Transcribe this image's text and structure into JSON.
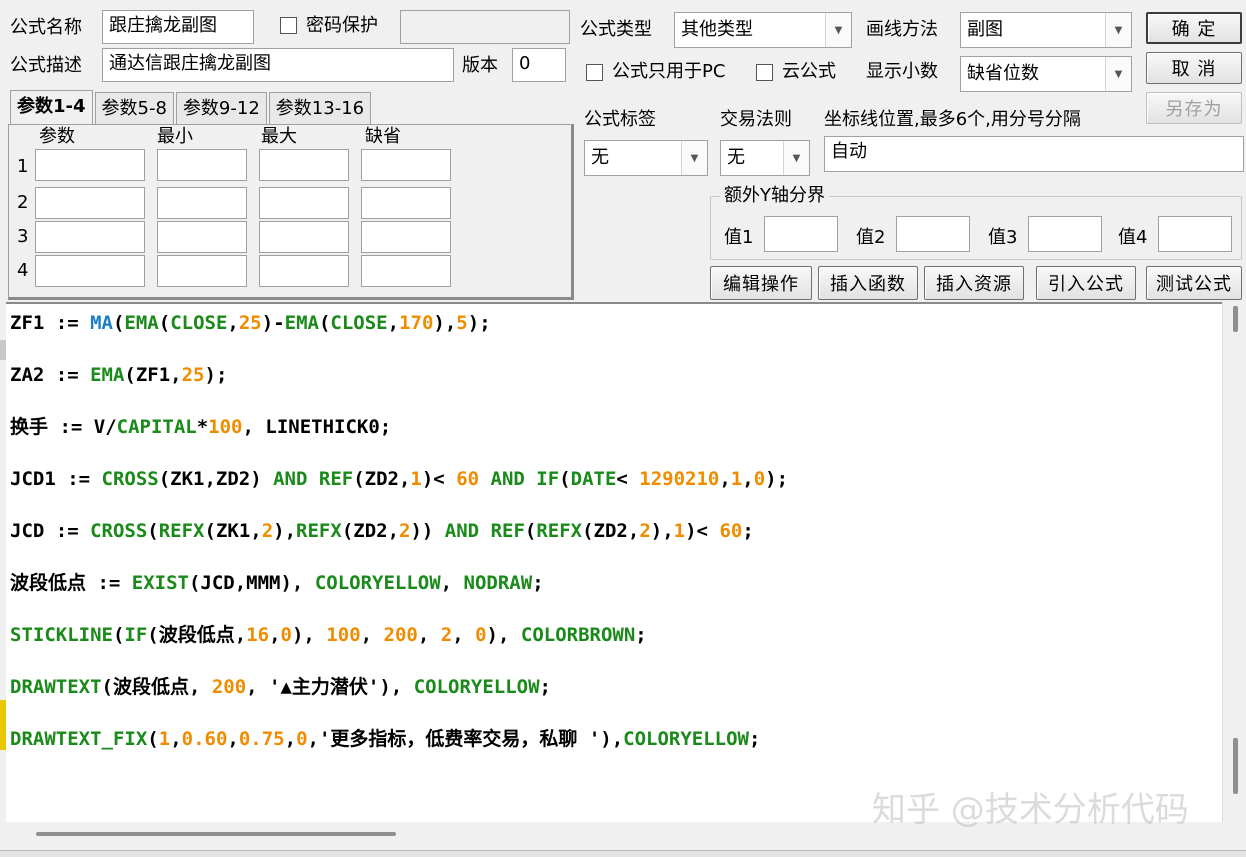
{
  "form": {
    "name_label": "公式名称",
    "name_value": "跟庄擒龙副图",
    "password_label": "密码保护",
    "password_value": "",
    "desc_label": "公式描述",
    "desc_value": "通达信跟庄擒龙副图",
    "version_label": "版本",
    "version_value": "0",
    "type_label": "公式类型",
    "type_value": "其他类型",
    "draw_label": "画线方法",
    "draw_value": "副图",
    "pc_only_label": "公式只用于PC",
    "cloud_label": "云公式",
    "decimals_label": "显示小数",
    "decimals_value": "缺省位数",
    "tag_label": "公式标签",
    "tag_value": "无",
    "rule_label": "交易法则",
    "rule_value": "无",
    "axis_label": "坐标线位置,最多6个,用分号分隔",
    "axis_value": "自动",
    "extra_y_label": "额外Y轴分界",
    "val1_label": "值1",
    "val2_label": "值2",
    "val3_label": "值3",
    "val4_label": "值4"
  },
  "buttons": {
    "ok": "确  定",
    "cancel": "取  消",
    "save_as": "另存为",
    "edit_ops": "编辑操作",
    "insert_func": "插入函数",
    "insert_res": "插入资源",
    "import_formula": "引入公式",
    "test_formula": "测试公式"
  },
  "tabs": [
    "参数1-4",
    "参数5-8",
    "参数9-12",
    "参数13-16"
  ],
  "params": {
    "headers": [
      "参数",
      "最小",
      "最大",
      "缺省"
    ],
    "rows": [
      "1",
      "2",
      "3",
      "4"
    ]
  },
  "code": [
    [
      [
        "ZF1 := ",
        "#000"
      ],
      [
        "MA",
        "#1a7fc8"
      ],
      [
        "(",
        "#000"
      ],
      [
        "EMA",
        "#1a8a1a"
      ],
      [
        "(",
        "#000"
      ],
      [
        "CLOSE",
        "#1a8a1a"
      ],
      [
        ",",
        "#000"
      ],
      [
        "25",
        "#f08c00"
      ],
      [
        ")-",
        "#000"
      ],
      [
        "EMA",
        "#1a8a1a"
      ],
      [
        "(",
        "#000"
      ],
      [
        "CLOSE",
        "#1a8a1a"
      ],
      [
        ",",
        "#000"
      ],
      [
        "170",
        "#f08c00"
      ],
      [
        "),",
        "#000"
      ],
      [
        "5",
        "#f08c00"
      ],
      [
        ");",
        "#000"
      ]
    ],
    [
      [
        "ZA2 := ",
        "#000"
      ],
      [
        "EMA",
        "#1a8a1a"
      ],
      [
        "(ZF1,",
        "#000"
      ],
      [
        "25",
        "#f08c00"
      ],
      [
        ");",
        "#000"
      ]
    ],
    [
      [
        "换手 := V/",
        "#000"
      ],
      [
        "CAPITAL",
        "#1a8a1a"
      ],
      [
        "*",
        "#000"
      ],
      [
        "100",
        "#f08c00"
      ],
      [
        ", LINETHICK0;",
        "#000"
      ]
    ],
    [
      [
        "JCD1 := ",
        "#000"
      ],
      [
        "CROSS",
        "#1a8a1a"
      ],
      [
        "(ZK1,ZD2) ",
        "#000"
      ],
      [
        "AND ",
        "#1a8a1a"
      ],
      [
        "REF",
        "#1a8a1a"
      ],
      [
        "(ZD2,",
        "#000"
      ],
      [
        "1",
        "#f08c00"
      ],
      [
        ")< ",
        "#000"
      ],
      [
        "60 ",
        "#f08c00"
      ],
      [
        "AND ",
        "#1a8a1a"
      ],
      [
        "IF",
        "#1a8a1a"
      ],
      [
        "(",
        "#000"
      ],
      [
        "DATE",
        "#1a8a1a"
      ],
      [
        "< ",
        "#000"
      ],
      [
        "1290210",
        "#f08c00"
      ],
      [
        ",",
        "#000"
      ],
      [
        "1",
        "#f08c00"
      ],
      [
        ",",
        "#000"
      ],
      [
        "0",
        "#f08c00"
      ],
      [
        ");",
        "#000"
      ]
    ],
    [
      [
        "JCD := ",
        "#000"
      ],
      [
        "CROSS",
        "#1a8a1a"
      ],
      [
        "(",
        "#000"
      ],
      [
        "REFX",
        "#1a8a1a"
      ],
      [
        "(ZK1,",
        "#000"
      ],
      [
        "2",
        "#f08c00"
      ],
      [
        "),",
        "#000"
      ],
      [
        "REFX",
        "#1a8a1a"
      ],
      [
        "(ZD2,",
        "#000"
      ],
      [
        "2",
        "#f08c00"
      ],
      [
        ")) ",
        "#000"
      ],
      [
        "AND ",
        "#1a8a1a"
      ],
      [
        "REF",
        "#1a8a1a"
      ],
      [
        "(",
        "#000"
      ],
      [
        "REFX",
        "#1a8a1a"
      ],
      [
        "(ZD2,",
        "#000"
      ],
      [
        "2",
        "#f08c00"
      ],
      [
        "),",
        "#000"
      ],
      [
        "1",
        "#f08c00"
      ],
      [
        ")< ",
        "#000"
      ],
      [
        "60",
        "#f08c00"
      ],
      [
        ";",
        "#000"
      ]
    ],
    [
      [
        "波段低点 := ",
        "#000"
      ],
      [
        "EXIST",
        "#1a8a1a"
      ],
      [
        "(JCD,MMM), ",
        "#000"
      ],
      [
        "COLORYELLOW",
        "#1a8a1a"
      ],
      [
        ", ",
        "#000"
      ],
      [
        "NODRAW",
        "#1a8a1a"
      ],
      [
        ";",
        "#000"
      ]
    ],
    [
      [
        "STICKLINE",
        "#1a8a1a"
      ],
      [
        "(",
        "#000"
      ],
      [
        "IF",
        "#1a8a1a"
      ],
      [
        "(波段低点,",
        "#000"
      ],
      [
        "16",
        "#f08c00"
      ],
      [
        ",",
        "#000"
      ],
      [
        "0",
        "#f08c00"
      ],
      [
        "), ",
        "#000"
      ],
      [
        "100",
        "#f08c00"
      ],
      [
        ", ",
        "#000"
      ],
      [
        "200",
        "#f08c00"
      ],
      [
        ", ",
        "#000"
      ],
      [
        "2",
        "#f08c00"
      ],
      [
        ", ",
        "#000"
      ],
      [
        "0",
        "#f08c00"
      ],
      [
        "), ",
        "#000"
      ],
      [
        "COLORBROWN",
        "#1a8a1a"
      ],
      [
        ";",
        "#000"
      ]
    ],
    [
      [
        "DRAWTEXT",
        "#1a8a1a"
      ],
      [
        "(波段低点, ",
        "#000"
      ],
      [
        "200",
        "#f08c00"
      ],
      [
        ", '▲主力潜伏'), ",
        "#000"
      ],
      [
        "COLORYELLOW",
        "#1a8a1a"
      ],
      [
        ";",
        "#000"
      ]
    ],
    [
      [
        "DRAWTEXT_FIX",
        "#1a8a1a"
      ],
      [
        "(",
        "#000"
      ],
      [
        "1",
        "#f08c00"
      ],
      [
        ",",
        "#000"
      ],
      [
        "0.60",
        "#f08c00"
      ],
      [
        ",",
        "#000"
      ],
      [
        "0.75",
        "#f08c00"
      ],
      [
        ",",
        "#000"
      ],
      [
        "0",
        "#f08c00"
      ],
      [
        ",'更多指标，低费率交易，私聊 '),",
        "#000"
      ],
      [
        "COLORYELLOW",
        "#1a8a1a"
      ],
      [
        ";",
        "#000"
      ]
    ]
  ],
  "watermark": "知乎 @技术分析代码"
}
